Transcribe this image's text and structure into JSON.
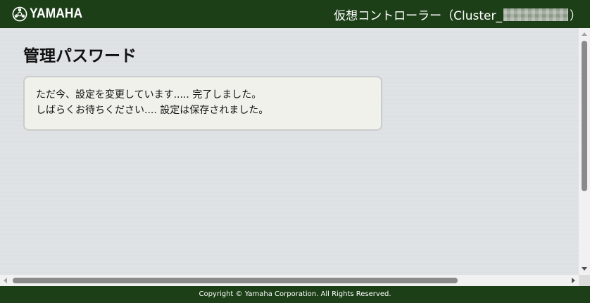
{
  "header": {
    "logo_text": "YAMAHA",
    "title_prefix": "仮想コントローラー（Cluster_",
    "title_suffix": "）"
  },
  "main": {
    "page_title": "管理パスワード",
    "message_lines": [
      "ただ今、設定を変更しています..... 完了しました。",
      "しばらくお待ちください.... 設定は保存されました。"
    ]
  },
  "footer": {
    "copyright": "Copyright © Yamaha Corporation. All Rights Reserved."
  },
  "colors": {
    "header_bg": "#1d3f17",
    "footer_bg": "#1d3f17",
    "message_box_bg": "#f1f1ec"
  },
  "icons": {
    "logo": "yamaha-tuning-fork-logo-icon"
  }
}
